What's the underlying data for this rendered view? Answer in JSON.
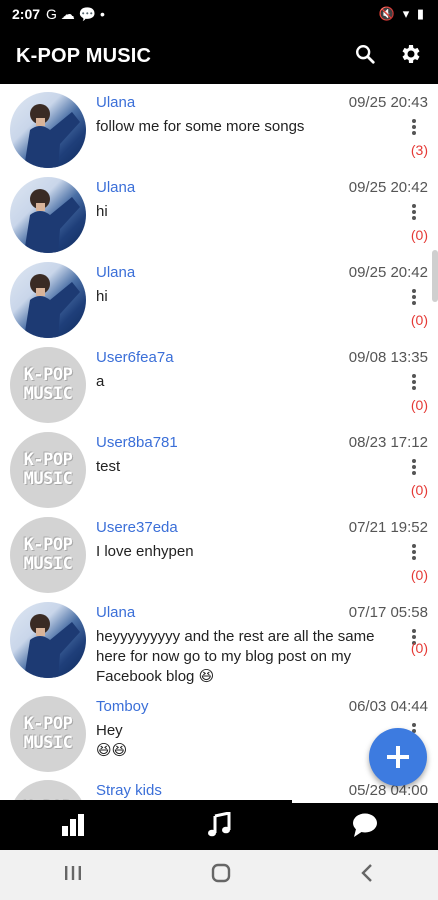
{
  "status_bar": {
    "time": "2:07",
    "left_icons": "G ☁ 💬 •",
    "right_icons": "🔇 ▾ ▮"
  },
  "app": {
    "title": "K-POP MUSIC"
  },
  "feed": [
    {
      "user": "Ulana",
      "date": "09/25 20:43",
      "message": "follow me for some more songs",
      "count": "(3)",
      "avatar": "photo"
    },
    {
      "user": "Ulana",
      "date": "09/25 20:42",
      "message": "hi",
      "count": "(0)",
      "avatar": "photo"
    },
    {
      "user": "Ulana",
      "date": "09/25 20:42",
      "message": "hi",
      "count": "(0)",
      "avatar": "photo"
    },
    {
      "user": "User6fea7a",
      "date": "09/08 13:35",
      "message": "a",
      "count": "(0)",
      "avatar": "logo"
    },
    {
      "user": "User8ba781",
      "date": "08/23 17:12",
      "message": "test",
      "count": "(0)",
      "avatar": "logo"
    },
    {
      "user": "Usere37eda",
      "date": "07/21 19:52",
      "message": "I love enhypen",
      "count": "(0)",
      "avatar": "logo"
    },
    {
      "user": "Ulana",
      "date": "07/17 05:58",
      "message": "heyyyyyyyyy and the rest are all the same here for now go to my blog post on my Facebook blog 😆",
      "count": "(0)",
      "avatar": "photo"
    },
    {
      "user": "Tomboy",
      "date": "06/03 04:44",
      "message": "Hey\n😆😆",
      "count": "",
      "avatar": "logo"
    },
    {
      "user": "Stray kids",
      "date": "05/28 04:00",
      "message": "",
      "count": "",
      "avatar": "logo"
    }
  ],
  "avatar_logo_text": [
    "K-POP",
    "MUSIC"
  ],
  "colors": {
    "accent": "#3d7be0",
    "username": "#3b6fd8",
    "count": "#e53935",
    "bar": "#000000"
  },
  "bottom_nav": [
    "chart-icon",
    "music-icon",
    "chat-icon"
  ],
  "system_nav": [
    "recents-icon",
    "home-icon",
    "back-icon"
  ]
}
